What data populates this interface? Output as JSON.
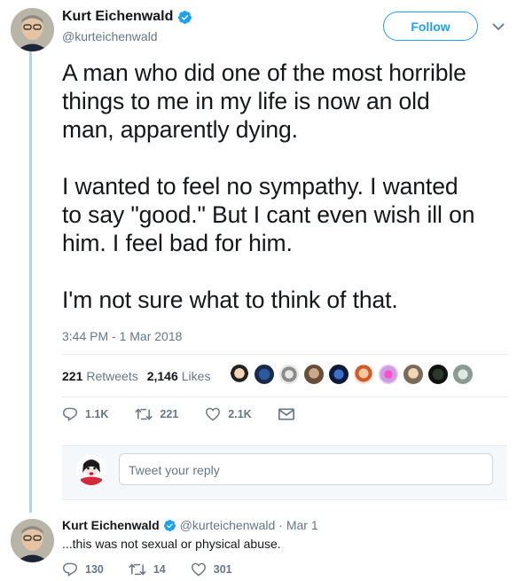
{
  "tweet": {
    "author": {
      "display_name": "Kurt Eichenwald",
      "handle": "@kurteichenwald",
      "verified": true
    },
    "follow_label": "Follow",
    "text_paragraphs": [
      "A man who did one of the most horrible",
      "things to me in my life is now an old",
      "man, apparently dying.",
      "I wanted to feel no sympathy. I wanted",
      "to say \"good.\" But I cant even wish ill on",
      "him. I feel bad for him.",
      "I'm not sure what to think of that."
    ],
    "timestamp": "3:44 PM - 1 Mar 2018",
    "stats": {
      "retweets_count": "221",
      "retweets_label": "Retweets",
      "likes_count": "2,146",
      "likes_label": "Likes"
    },
    "actions": {
      "replies": "1.1K",
      "retweets": "221",
      "likes": "2.1K"
    }
  },
  "reply_composer": {
    "placeholder": "Tweet your reply"
  },
  "reply_tweet": {
    "display_name": "Kurt Eichenwald",
    "handle": "@kurteichenwald",
    "date": "· Mar 1",
    "text": "...this was not sexual or physical abuse.",
    "actions": {
      "replies": "130",
      "retweets": "14",
      "likes": "301"
    }
  },
  "colors": {
    "accent": "#1da1f2",
    "muted": "#657786",
    "thread_line": "#a6d8ee"
  }
}
